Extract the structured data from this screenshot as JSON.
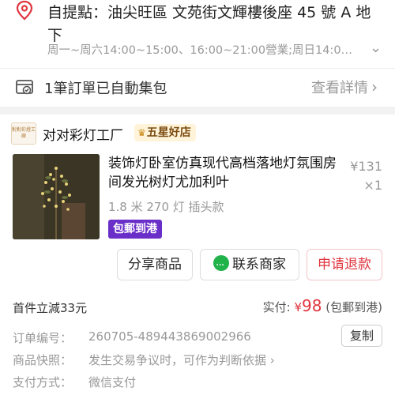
{
  "pickup": {
    "address": "自提點：油尖旺區 文苑街文輝樓後座 45 號 A 地下",
    "hours": "周一~周六14:00~15:00、16:00~21:00營業;周日14:0…",
    "consolidation_text": "1筆訂單已自動集包",
    "details_link": "查看詳情"
  },
  "shop": {
    "logo_text": "對對彩燈工廠",
    "name": "对对彩灯工厂",
    "badge": "五星好店"
  },
  "product": {
    "title": "装饰灯卧室仿真现代高档落地灯氛围房间发光树灯尤加利叶",
    "price": "¥131",
    "quantity": "×1",
    "spec": "1.8 米 270 灯  插头款",
    "shipping_tag": "包郵到港"
  },
  "actions": {
    "share": "分享商品",
    "contact": "联系商家",
    "refund": "申请退款"
  },
  "totals": {
    "first_discount": "首件立減33元",
    "paid_label": "实付:",
    "currency": "¥",
    "paid_amount": "98",
    "paid_note": "(包郵到港)"
  },
  "order_info": {
    "order_no_label": "订单编号：",
    "order_no": "260705-489443869002966",
    "copy_label": "复制",
    "snapshot_label": "商品快照：",
    "snapshot_value": "发生交易争议时，可作为判断依据",
    "payment_label": "支付方式：",
    "payment_value": "微信支付"
  },
  "colors": {
    "accent_red": "#e0353f",
    "tag_purple": "#6a2fc8",
    "badge_bg": "#fff4d9"
  },
  "icons": {
    "pickup": "location-pin-icon",
    "package": "package-check-icon",
    "chat": "wechat-icon"
  }
}
